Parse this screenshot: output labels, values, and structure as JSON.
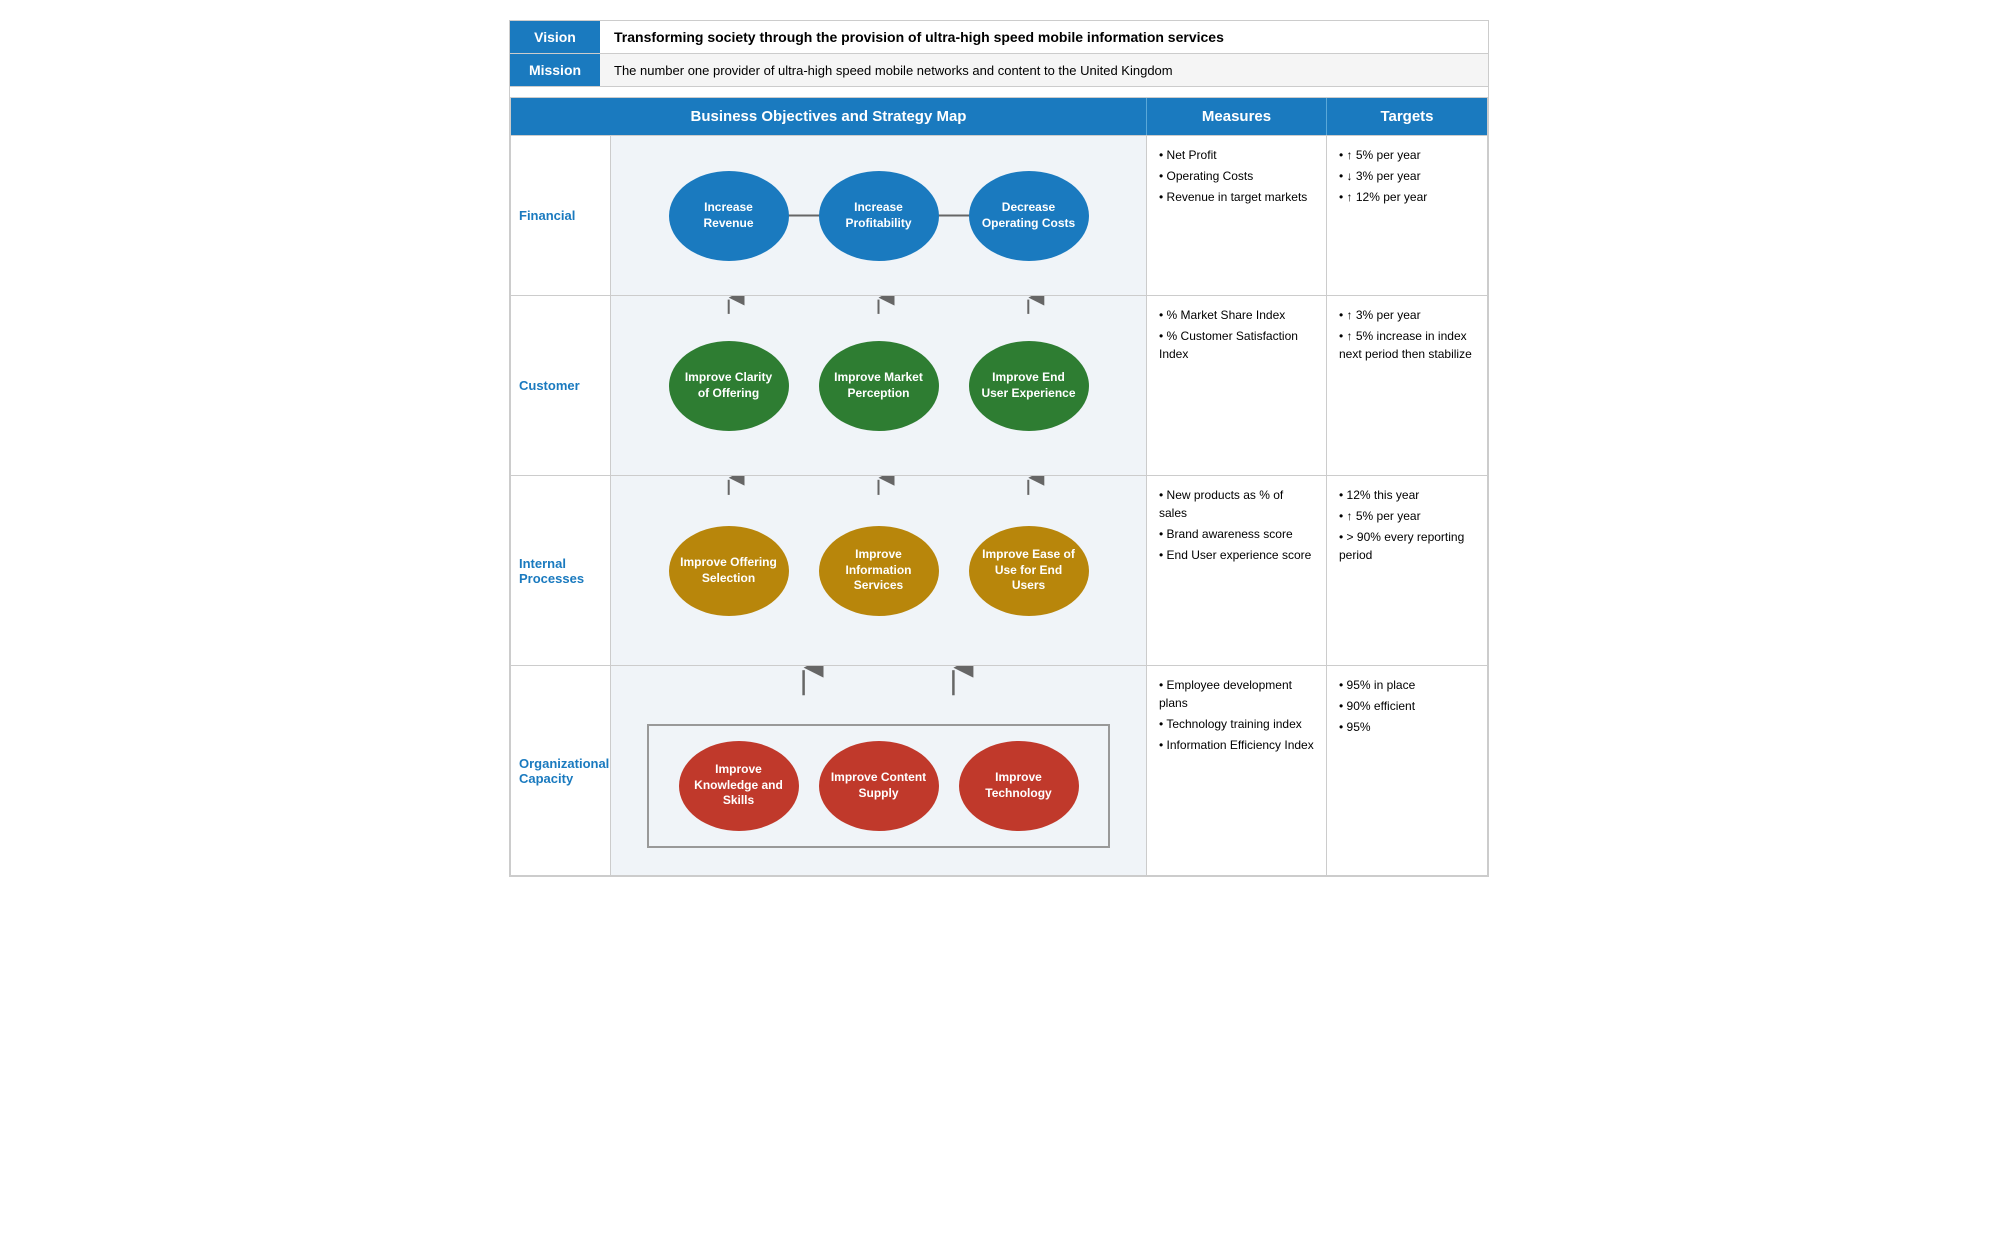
{
  "vision": {
    "label": "Vision",
    "text": "Transforming society through the provision of ultra-high speed mobile information services"
  },
  "mission": {
    "label": "Mission",
    "text": "The number one provider of ultra-high speed mobile networks and content to the United Kingdom"
  },
  "header": {
    "main": "Business Objectives and Strategy Map",
    "measures": "Measures",
    "targets": "Targets"
  },
  "rows": [
    {
      "id": "financial",
      "label": "Financial",
      "nodes": [
        {
          "text": "Increase Revenue",
          "color": "blue"
        },
        {
          "text": "Increase Profitability",
          "color": "blue"
        },
        {
          "text": "Decrease Operating Costs",
          "color": "blue"
        }
      ],
      "measures": [
        "Net Profit",
        "Operating Costs",
        "Revenue in target markets"
      ],
      "targets": [
        "↑ 5% per year",
        "↓ 3% per year",
        "↑ 12% per year"
      ]
    },
    {
      "id": "customer",
      "label": "Customer",
      "nodes": [
        {
          "text": "Improve Clarity of Offering",
          "color": "green"
        },
        {
          "text": "Improve Market Perception",
          "color": "green"
        },
        {
          "text": "Improve End User Experience",
          "color": "green"
        }
      ],
      "measures": [
        "% Market Share Index",
        "% Customer Satisfaction Index"
      ],
      "targets": [
        "↑ 3% per year",
        "↑ 5% increase in index next period then stabilize"
      ]
    },
    {
      "id": "internal",
      "label": "Internal Processes",
      "nodes": [
        {
          "text": "Improve Offering Selection",
          "color": "gold"
        },
        {
          "text": "Improve Information Services",
          "color": "gold"
        },
        {
          "text": "Improve Ease of Use for End Users",
          "color": "gold"
        }
      ],
      "measures": [
        "New products as % of sales",
        "Brand awareness score",
        "End User experience score"
      ],
      "targets": [
        "12% this year",
        "↑ 5% per year",
        "> 90% every reporting period"
      ]
    },
    {
      "id": "org",
      "label": "Organizational Capacity",
      "nodes": [
        {
          "text": "Improve Knowledge and Skills",
          "color": "red"
        },
        {
          "text": "Improve Content Supply",
          "color": "red"
        },
        {
          "text": "Improve Technology",
          "color": "red"
        }
      ],
      "measures": [
        "Employee development plans",
        "Technology training index",
        "Information Efficiency Index"
      ],
      "targets": [
        "95% in place",
        "90% efficient",
        "95%"
      ]
    }
  ]
}
